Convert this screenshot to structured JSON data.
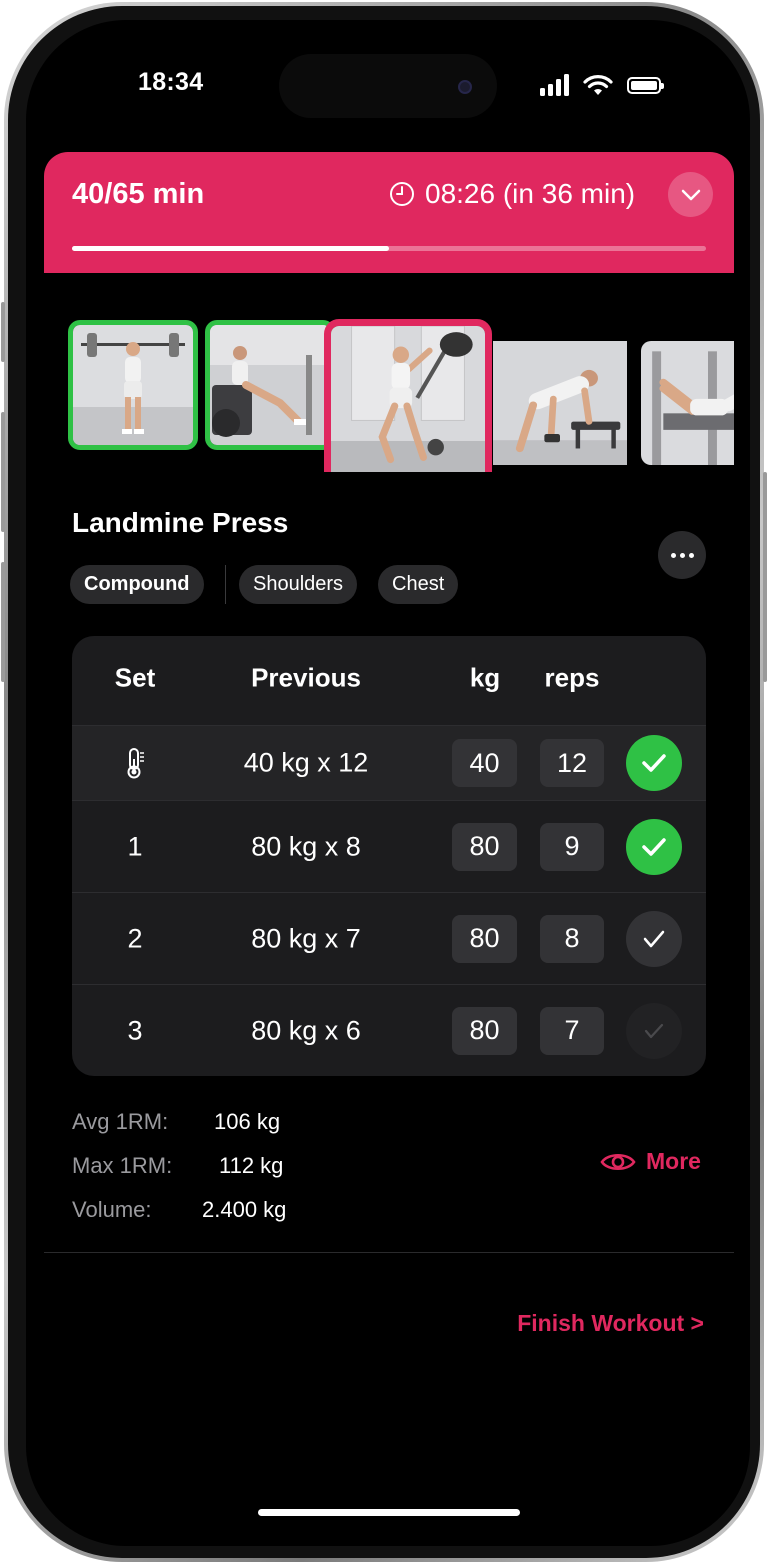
{
  "status_bar": {
    "time": "18:34"
  },
  "workout": {
    "elapsed": "40/65 min",
    "end_time": "08:26 (in 36 min)",
    "progress": 0.5,
    "accent_color": "#e0285f",
    "complete_color": "#2fc145"
  },
  "exercises": [
    {
      "state": "completed"
    },
    {
      "state": "completed"
    },
    {
      "state": "current"
    },
    {
      "state": "upcoming"
    },
    {
      "state": "upcoming"
    }
  ],
  "exercise": {
    "title": "Landmine Press",
    "tags": [
      "Compound",
      "Shoulders",
      "Chest"
    ]
  },
  "sets_table": {
    "headers": {
      "set": "Set",
      "previous": "Previous",
      "kg": "kg",
      "reps": "reps"
    },
    "rows": [
      {
        "set": "",
        "set_icon": "thermometer-icon",
        "previous": "40 kg x 12",
        "kg": "40",
        "reps": "12",
        "status": "completed"
      },
      {
        "set": "1",
        "previous": "80 kg x 8",
        "kg": "80",
        "reps": "9",
        "status": "completed"
      },
      {
        "set": "2",
        "previous": "80 kg x 7",
        "kg": "80",
        "reps": "8",
        "status": "pending"
      },
      {
        "set": "3",
        "previous": "80 kg x 6",
        "kg": "80",
        "reps": "7",
        "status": "inactive"
      }
    ]
  },
  "stats": {
    "avg_label": "Avg 1RM:",
    "avg_value": "106 kg",
    "max_label": "Max 1RM:",
    "max_value": "112 kg",
    "volume_label": "Volume:",
    "volume_value": "2.400 kg"
  },
  "actions": {
    "more": "More",
    "finish": "Finish Workout >"
  }
}
